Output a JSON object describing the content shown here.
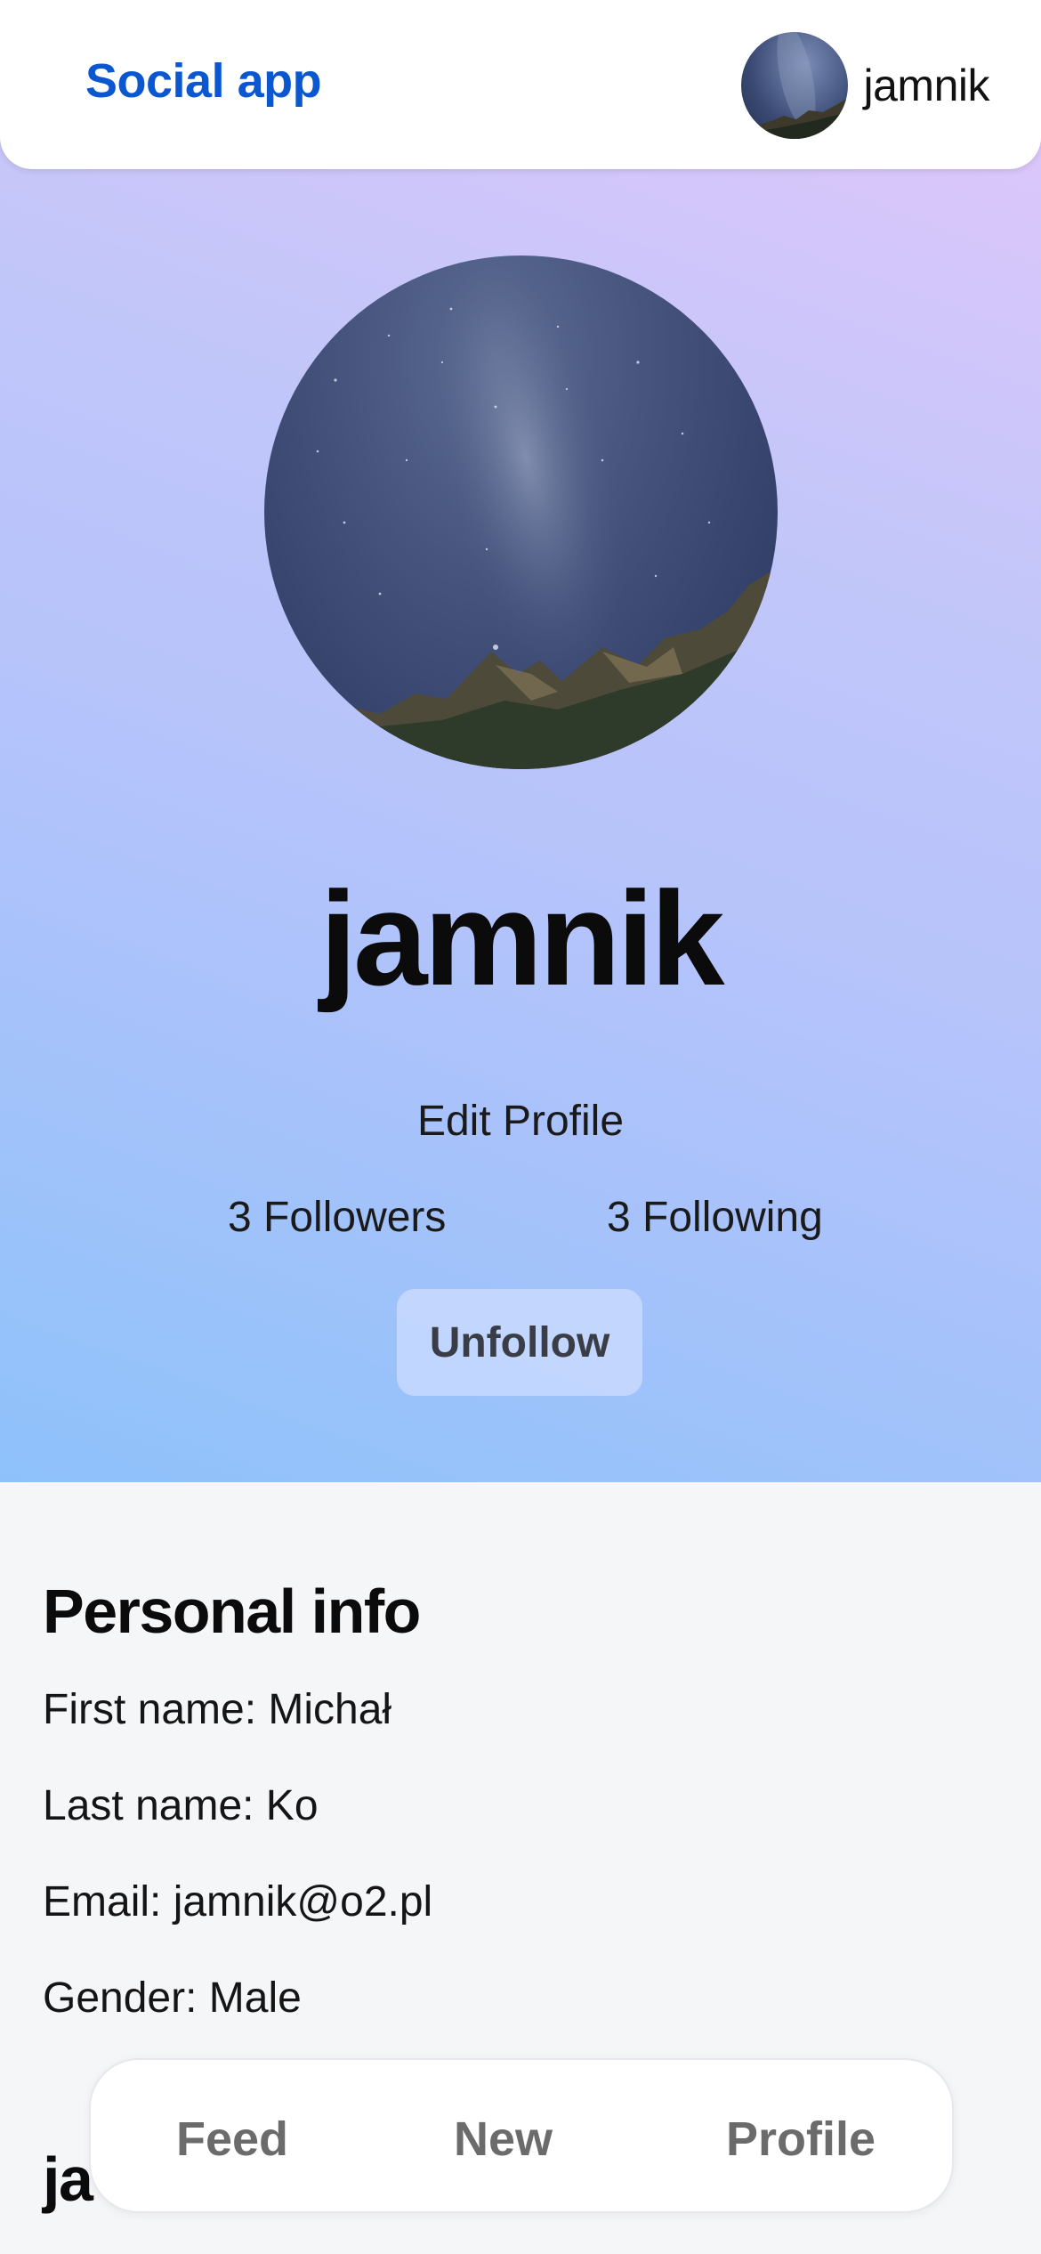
{
  "header": {
    "brand": "Social app",
    "username": "jamnik"
  },
  "profile": {
    "name": "jamnik",
    "edit_label": "Edit Profile",
    "followers_label": "3 Followers",
    "following_label": "3 Following",
    "unfollow_label": "Unfollow"
  },
  "personal_info": {
    "title": "Personal info",
    "rows": [
      "First name: Michał",
      "Last name: Ko",
      "Email: jamnik@o2.pl",
      "Gender: Male"
    ]
  },
  "section2": {
    "title_partial": "ja"
  },
  "nav": {
    "items": [
      "Feed",
      "New",
      "Profile"
    ]
  },
  "colors": {
    "brand": "#0b57d0",
    "gradient_start": "#e3c6fb",
    "gradient_end": "#8ec1fa"
  },
  "icons": {
    "avatar": "night-sky-mountain-photo"
  }
}
